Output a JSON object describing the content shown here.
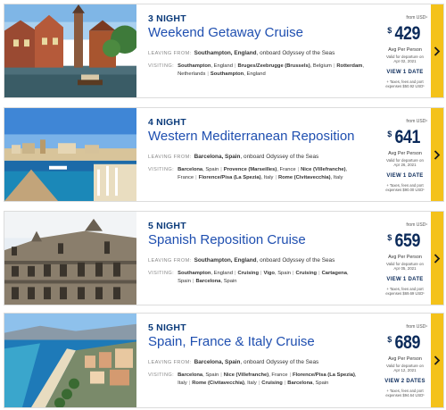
{
  "cruises": [
    {
      "nights": "3 NIGHT",
      "title": "Weekend Getaway Cruise",
      "leaving_label": "LEAVING FROM:",
      "leaving_port": "Southampton, England",
      "leaving_ship": ", onboard Odyssey of the Seas",
      "visiting_label": "VISITING:",
      "ports": [
        {
          "name": "Southampton",
          "suffix": ", England"
        },
        {
          "name": "Bruges/Zeebrugge (Brussels)",
          "suffix": ", Belgium"
        },
        {
          "name": "Rotterdam",
          "suffix": ", Netherlands"
        },
        {
          "name": "Southampton",
          "suffix": ", England"
        }
      ],
      "from_label": "from USD¹",
      "currency": "$",
      "price": "429",
      "per_person": "Avg Per Person",
      "valid_line1": "Valid for departure on",
      "valid_line2": "Apr 02, 2021",
      "dates_label": "VIEW 1 DATE",
      "taxes_line1": "+ Taxes, fees and port",
      "taxes_line2": "expenses $50.92 USD¹",
      "image_icon": "bruges-canal-photo"
    },
    {
      "nights": "4 NIGHT",
      "title": "Western Mediterranean Reposition",
      "leaving_label": "LEAVING FROM:",
      "leaving_port": "Barcelona, Spain",
      "leaving_ship": ", onboard Odyssey of the Seas",
      "visiting_label": "VISITING:",
      "ports": [
        {
          "name": "Barcelona",
          "suffix": ", Spain"
        },
        {
          "name": "Provence (Marseilles)",
          "suffix": ", France"
        },
        {
          "name": "Nice (Villefranche)",
          "suffix": ", France"
        },
        {
          "name": "Florence/Pisa (La Spezia)",
          "suffix": ", Italy"
        },
        {
          "name": "Rome (Civitavecchia)",
          "suffix": ", Italy"
        }
      ],
      "from_label": "from USD¹",
      "currency": "$",
      "price": "641",
      "per_person": "Avg Per Person",
      "valid_line1": "Valid for departure on",
      "valid_line2": "Apr 26, 2021",
      "dates_label": "VIEW 1 DATE",
      "taxes_line1": "+ Taxes, fees and port",
      "taxes_line2": "expenses $90.00 USD¹",
      "image_icon": "marseille-harbor-photo"
    },
    {
      "nights": "5 NIGHT",
      "title": "Spanish Reposition Cruise",
      "leaving_label": "LEAVING FROM:",
      "leaving_port": "Southampton, England",
      "leaving_ship": ", onboard Odyssey of the Seas",
      "visiting_label": "VISITING:",
      "ports": [
        {
          "name": "Southampton",
          "suffix": ", England"
        },
        {
          "name": "Cruising",
          "suffix": ""
        },
        {
          "name": "Vigo",
          "suffix": ", Spain"
        },
        {
          "name": "Cruising",
          "suffix": ""
        },
        {
          "name": "Cartagena",
          "suffix": ", Spain"
        },
        {
          "name": "Barcelona",
          "suffix": ", Spain"
        }
      ],
      "from_label": "from USD¹",
      "currency": "$",
      "price": "659",
      "per_person": "Avg Per Person",
      "valid_line1": "Valid for departure on",
      "valid_line2": "Apr 05, 2021",
      "dates_label": "VIEW 1 DATE",
      "taxes_line1": "+ Taxes, fees and port",
      "taxes_line2": "expenses $69.69 USD¹",
      "image_icon": "spanish-building-photo"
    },
    {
      "nights": "5 NIGHT",
      "title": "Spain, France & Italy Cruise",
      "leaving_label": "LEAVING FROM:",
      "leaving_port": "Barcelona, Spain",
      "leaving_ship": ", onboard Odyssey of the Seas",
      "visiting_label": "VISITING:",
      "ports": [
        {
          "name": "Barcelona",
          "suffix": ", Spain"
        },
        {
          "name": "Nice (Villefranche)",
          "suffix": ", France"
        },
        {
          "name": "Florence/Pisa (La Spezia)",
          "suffix": ", Italy"
        },
        {
          "name": "Rome (Civitavecchia)",
          "suffix": ", Italy"
        },
        {
          "name": "Cruising",
          "suffix": ""
        },
        {
          "name": "Barcelona",
          "suffix": ", Spain"
        }
      ],
      "from_label": "from USD¹",
      "currency": "$",
      "price": "689",
      "per_person": "Avg Per Person",
      "valid_line1": "Valid for departure on",
      "valid_line2": "Apr 12, 2021",
      "dates_label": "VIEW 2 DATES",
      "taxes_line1": "+ Taxes, fees and port",
      "taxes_line2": "expenses $94.64 USD¹",
      "image_icon": "nice-coastline-photo"
    }
  ],
  "colors": {
    "title_blue": "#1f4fb0",
    "nights_navy": "#0a3a7a",
    "price_navy": "#0a2a5a",
    "arrow_yellow": "#f4c21a"
  },
  "icons": {
    "arrow": "chevron-right-icon"
  }
}
